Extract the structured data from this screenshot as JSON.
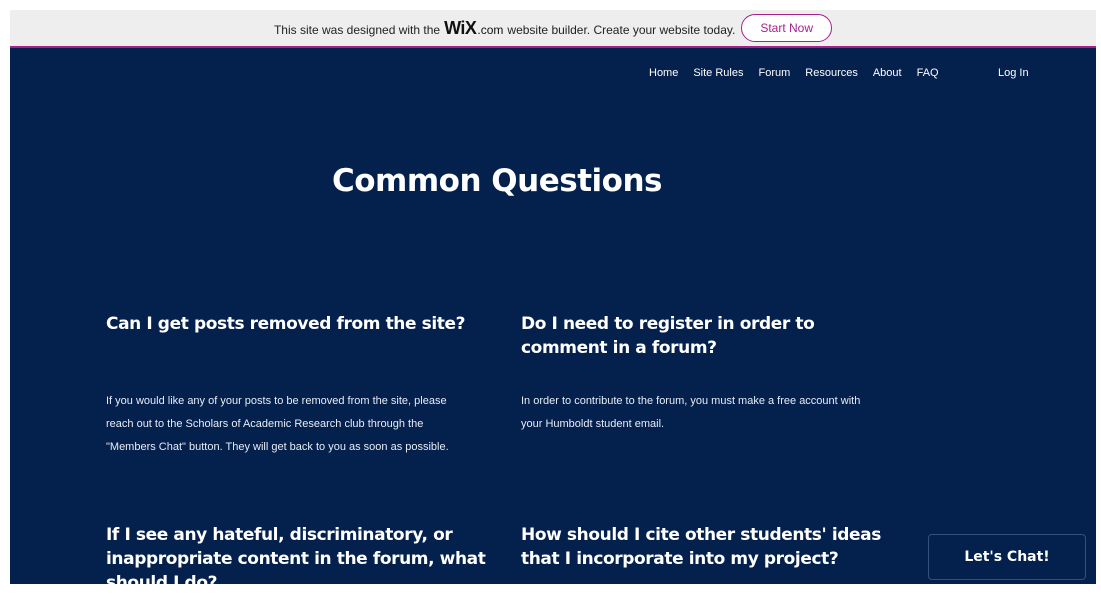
{
  "banner": {
    "text_before": "This site was designed with the",
    "logo": "WiX",
    "logo_suffix": ".com",
    "text_after": "website builder. Create your website today.",
    "cta": "Start Now",
    "accent_color": "#a81f8c"
  },
  "nav": {
    "items": [
      {
        "label": "Home"
      },
      {
        "label": "Site Rules"
      },
      {
        "label": "Forum"
      },
      {
        "label": "Resources"
      },
      {
        "label": "About"
      },
      {
        "label": "FAQ"
      }
    ],
    "login": "Log In"
  },
  "main": {
    "title": "Common Questions",
    "background_color": "#04204d",
    "faqs": [
      {
        "question": "Can I get posts removed from the site?",
        "answer_lines": [
          "If you would like any of your posts to be removed from the site, please",
          "reach out to the Scholars of Academic Research club through the",
          "\"Members Chat\" button. They will get back to you as soon as possible."
        ]
      },
      {
        "question": "Do I need to register in order to comment in a forum?",
        "answer_lines": [
          "In order to contribute to the forum, you must make a free account with",
          "your Humboldt student email."
        ]
      },
      {
        "question": "If I see any hateful, discriminatory, or inappropriate content in the forum, what should I do?"
      },
      {
        "question": "How should I cite other students' ideas that I incorporate into my project?"
      }
    ]
  },
  "chat": {
    "label": "Let's Chat!"
  }
}
